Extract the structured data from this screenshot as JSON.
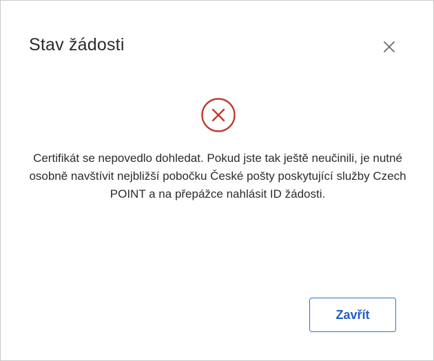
{
  "dialog": {
    "title": "Stav žádosti",
    "close_icon": "close-icon",
    "status_icon": "error-circle-x-icon",
    "status_color": "#c0392b",
    "message": "Certifikát se nepovedlo dohledat. Pokud jste tak ještě neučinili, je nutné osobně navštívit nejbližší pobočku České pošty poskytující služby Czech POINT a na přepážce nahlásit ID žádosti.",
    "close_button_label": "Zavřít",
    "accent_color": "#2f6fd0"
  }
}
